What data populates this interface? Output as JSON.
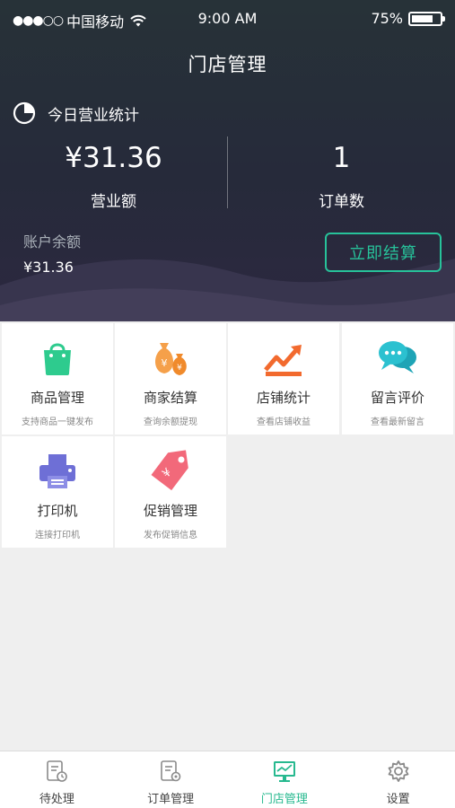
{
  "status_bar": {
    "signal": "●●●○○",
    "carrier": "中国移动",
    "time": "9:00 AM",
    "battery_text": "75%",
    "battery_level": 0.75
  },
  "nav": {
    "title": "门店管理"
  },
  "today": {
    "title": "今日营业统计",
    "revenue_value": "¥31.36",
    "revenue_label": "营业额",
    "orders_value": "1",
    "orders_label": "订单数"
  },
  "balance": {
    "label": "账户余额",
    "value": "¥31.36",
    "settle_button": "立即结算"
  },
  "tiles": [
    {
      "title": "商品管理",
      "subtitle": "支持商品一键发布",
      "icon": "shopping-bag-icon",
      "color": "#2ecb8e"
    },
    {
      "title": "商家结算",
      "subtitle": "查询余额提现",
      "icon": "money-bag-icon",
      "color": "#f5a04a"
    },
    {
      "title": "店铺统计",
      "subtitle": "查看店铺收益",
      "icon": "trend-chart-icon",
      "color": "#f26a2e"
    },
    {
      "title": "留言评价",
      "subtitle": "查看最新留言",
      "icon": "chat-bubbles-icon",
      "color": "#2bb8c9"
    },
    {
      "title": "打印机",
      "subtitle": "连接打印机",
      "icon": "printer-icon",
      "color": "#6e6fd6"
    },
    {
      "title": "促销管理",
      "subtitle": "发布促销信息",
      "icon": "price-tag-icon",
      "color": "#f2697a"
    }
  ],
  "tabbar": {
    "items": [
      {
        "label": "待处理",
        "icon": "pending-doc-icon",
        "active": false
      },
      {
        "label": "订单管理",
        "icon": "order-doc-icon",
        "active": false
      },
      {
        "label": "门店管理",
        "icon": "store-monitor-icon",
        "active": true
      },
      {
        "label": "设置",
        "icon": "gear-icon",
        "active": false
      }
    ]
  },
  "colors": {
    "accent": "#27c29a",
    "header_bg": "#262a3a"
  }
}
